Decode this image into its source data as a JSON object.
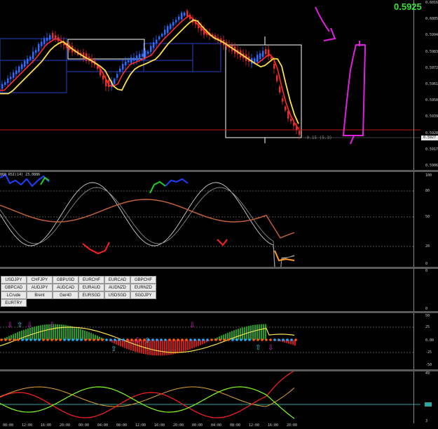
{
  "price_display": "0.5925",
  "price_axis": {
    "ticks": [
      "0.6016",
      "0.6005",
      "0.5994",
      "0.5983",
      "0.5972",
      "0.5961",
      "0.5950",
      "0.5939",
      "0.5928",
      "0.5917",
      "0.5906"
    ],
    "current_badge": "0.5927"
  },
  "annotation": "-0.15 (5.3)",
  "rsi": {
    "title": "860 RSI(14) 23.0886",
    "ticks": [
      "100",
      "80",
      "50",
      "20",
      "0"
    ]
  },
  "symbols": {
    "buttons": [
      "USDJPY",
      "CHFJPY",
      "GBPUSD",
      "EURCHF",
      "EURCAD",
      "GBPCHF",
      "GBPCAD",
      "AUDJPY",
      "AUDCAD",
      "EURAUD",
      "AUDNZD",
      "EURNZD",
      "LCrude",
      "Brent",
      "Ger40",
      "EURSGD",
      "USDSGD",
      "SGDJPY",
      "EURTRY"
    ],
    "ticks": [
      "0",
      "0"
    ]
  },
  "histogram": {
    "ticks": [
      "50",
      "25",
      "0.00",
      "-25",
      "-50"
    ]
  },
  "oscillator": {
    "ticks": [
      "49",
      "3"
    ]
  },
  "colors": {
    "bull_candle": "#2f6bff",
    "bear_candle": "#e03030",
    "ma_yellow": "#ffe24a",
    "ma_red": "#ff2a2a",
    "box": "#ffffff",
    "magenta_drawing": "#e020e0",
    "price_green": "#39e239"
  },
  "time_axis": [
    "08:00",
    "12:00",
    "16:00",
    "20:00",
    "00:00",
    "04:00",
    "08:00",
    "12:00",
    "16:00",
    "20:00",
    "00:00",
    "04:00",
    "08:00",
    "12:00",
    "16:00",
    "20:00"
  ]
}
